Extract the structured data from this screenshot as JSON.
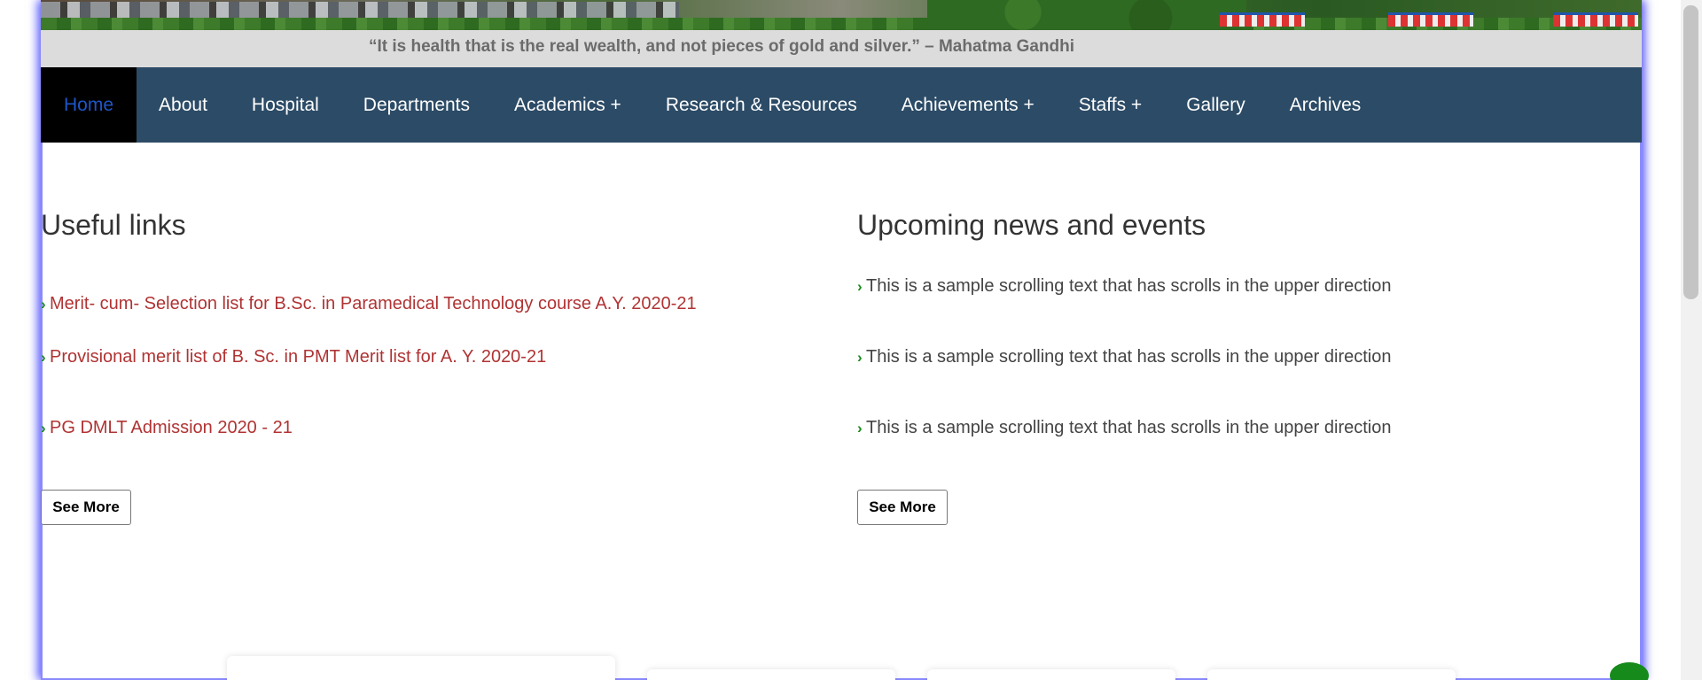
{
  "quote": "“It is health that is the real wealth, and not pieces of gold and silver.” – Mahatma Gandhi",
  "nav": {
    "items": [
      {
        "label": "Home",
        "active": true
      },
      {
        "label": "About"
      },
      {
        "label": "Hospital"
      },
      {
        "label": "Departments"
      },
      {
        "label": "Academics +"
      },
      {
        "label": "Research & Resources"
      },
      {
        "label": "Achievements +"
      },
      {
        "label": "Staffs +"
      },
      {
        "label": "Gallery"
      },
      {
        "label": "Archives"
      }
    ]
  },
  "useful_links": {
    "title": "Useful links",
    "items": [
      "Merit- cum- Selection list for B.Sc. in Paramedical Technology course A.Y. 2020-21",
      "Provisional merit list of B. Sc. in PMT Merit list for A. Y. 2020-21",
      "PG DMLT Admission 2020 - 21"
    ],
    "see_more": "See More"
  },
  "news": {
    "title": "Upcoming news and events",
    "items": [
      "This is a sample scrolling text that has scrolls in the upper direction",
      "This is a sample scrolling text that has scrolls in the upper direction",
      "This is a sample scrolling text that has scrolls in the upper direction"
    ],
    "see_more": "See More"
  },
  "colors": {
    "nav_bg": "#2c4b66",
    "active_nav_bg": "#000000",
    "active_nav_text": "#1e56c8",
    "link_color": "#b03333",
    "chevron_color": "#1a8a1a",
    "frame_glow": "#6a6aff"
  },
  "icons": {
    "bullet": "chevron-right-icon",
    "chat": "chat-icon"
  }
}
